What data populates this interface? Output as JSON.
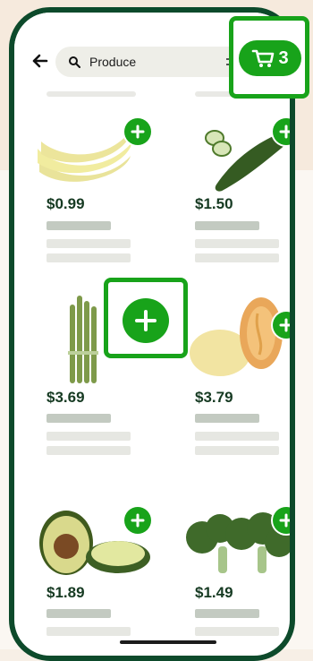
{
  "search": {
    "query": "Produce"
  },
  "cart": {
    "count": "3"
  },
  "products": [
    {
      "name": "Bananas",
      "price": "$0.99"
    },
    {
      "name": "Cucumber",
      "price": "$1.50"
    },
    {
      "name": "Asparagus",
      "price": "$3.69"
    },
    {
      "name": "Spaghetti squash",
      "price": "$3.79"
    },
    {
      "name": "Avocado",
      "price": "$1.89"
    },
    {
      "name": "Broccoli",
      "price": "$1.49"
    }
  ],
  "colors": {
    "brand_green": "#18a31a",
    "frame_dark_green": "#0d4a2b",
    "price_text": "#163a22"
  }
}
